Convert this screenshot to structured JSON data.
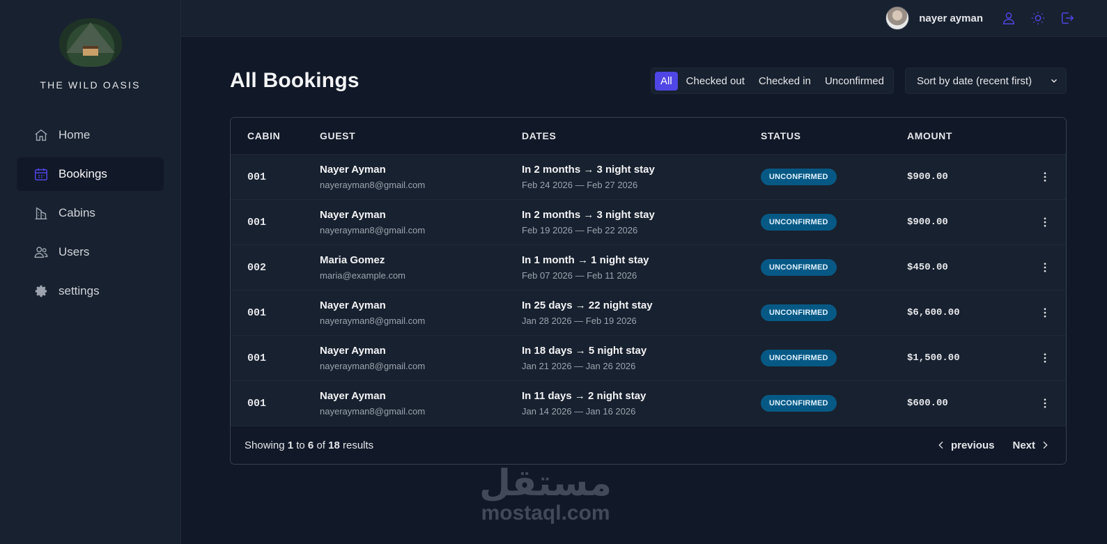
{
  "brand": {
    "name": "THE WILD OASIS"
  },
  "sidebar": {
    "items": [
      {
        "label": "Home",
        "icon": "home-icon"
      },
      {
        "label": "Bookings",
        "icon": "calendar-icon",
        "active": true
      },
      {
        "label": "Cabins",
        "icon": "building-icon"
      },
      {
        "label": "Users",
        "icon": "users-icon"
      },
      {
        "label": "settings",
        "icon": "gear-icon"
      }
    ]
  },
  "header": {
    "user_name": "nayer ayman",
    "icons": [
      "user-icon",
      "sun-icon",
      "logout-icon"
    ]
  },
  "page": {
    "title": "All Bookings"
  },
  "filters": {
    "options": [
      "All",
      "Checked out",
      "Checked in",
      "Unconfirmed"
    ],
    "active": "All"
  },
  "sort": {
    "selected": "Sort by date (recent first)"
  },
  "table": {
    "columns": [
      "CABIN",
      "GUEST",
      "DATES",
      "STATUS",
      "AMOUNT"
    ],
    "rows": [
      {
        "cabin": "001",
        "guest": "Nayer Ayman",
        "email": "nayerayman8@gmail.com",
        "stay": "In 2 months → 3 night stay",
        "range": "Feb 24 2026 — Feb 27 2026",
        "status": "UNCONFIRMED",
        "amount": "$900.00"
      },
      {
        "cabin": "001",
        "guest": "Nayer Ayman",
        "email": "nayerayman8@gmail.com",
        "stay": "In 2 months → 3 night stay",
        "range": "Feb 19 2026 — Feb 22 2026",
        "status": "UNCONFIRMED",
        "amount": "$900.00"
      },
      {
        "cabin": "002",
        "guest": "Maria Gomez",
        "email": "maria@example.com",
        "stay": "In 1 month → 1 night stay",
        "range": "Feb 07 2026 — Feb 11 2026",
        "status": "UNCONFIRMED",
        "amount": "$450.00"
      },
      {
        "cabin": "001",
        "guest": "Nayer Ayman",
        "email": "nayerayman8@gmail.com",
        "stay": "In 25 days → 22 night stay",
        "range": "Jan 28 2026 — Feb 19 2026",
        "status": "UNCONFIRMED",
        "amount": "$6,600.00"
      },
      {
        "cabin": "001",
        "guest": "Nayer Ayman",
        "email": "nayerayman8@gmail.com",
        "stay": "In 18 days → 5 night stay",
        "range": "Jan 21 2026 — Jan 26 2026",
        "status": "UNCONFIRMED",
        "amount": "$1,500.00"
      },
      {
        "cabin": "001",
        "guest": "Nayer Ayman",
        "email": "nayerayman8@gmail.com",
        "stay": "In 11 days → 2 night stay",
        "range": "Jan 14 2026 — Jan 16 2026",
        "status": "UNCONFIRMED",
        "amount": "$600.00"
      }
    ]
  },
  "pagination": {
    "prefix": "Showing",
    "from": "1",
    "to_word": "to",
    "to": "6",
    "of_word": "of",
    "total": "18",
    "suffix": "results",
    "prev_label": "previous",
    "next_label": "Next"
  },
  "colors": {
    "accent": "#4f46e5",
    "badge": "#075985",
    "bg": "#111827",
    "panel": "#18212f"
  },
  "watermark": {
    "arabic": "مستقل",
    "latin": "mostaql.com"
  }
}
